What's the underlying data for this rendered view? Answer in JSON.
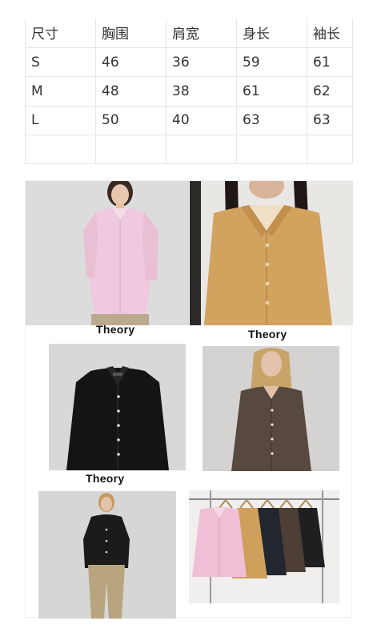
{
  "size_table": {
    "headers": [
      "尺寸",
      "胸围",
      "肩宽",
      "身长",
      "袖长"
    ],
    "rows": [
      [
        "S",
        "46",
        "36",
        "59",
        "61"
      ],
      [
        "M",
        "48",
        "38",
        "61",
        "62"
      ],
      [
        "L",
        "50",
        "40",
        "63",
        "63"
      ],
      [
        "",
        "",
        "",
        "",
        ""
      ]
    ]
  },
  "collage": {
    "brand_labels": [
      "Theory",
      "Theory",
      "Theory"
    ],
    "photos": [
      {
        "name": "pink-shirt-model-photo",
        "shirt_color": "#efc9dd"
      },
      {
        "name": "camel-cardigan-model-photo",
        "shirt_color": "#d2a35f"
      },
      {
        "name": "black-shirt-product-photo",
        "shirt_color": "#141414"
      },
      {
        "name": "brown-shirt-model-photo",
        "shirt_color": "#574840"
      },
      {
        "name": "black-shirt-fullbody-photo",
        "shirt_color": "#1b1b1b"
      },
      {
        "name": "color-variants-rack-photo",
        "shirt_color": "#efbfd5"
      }
    ]
  }
}
